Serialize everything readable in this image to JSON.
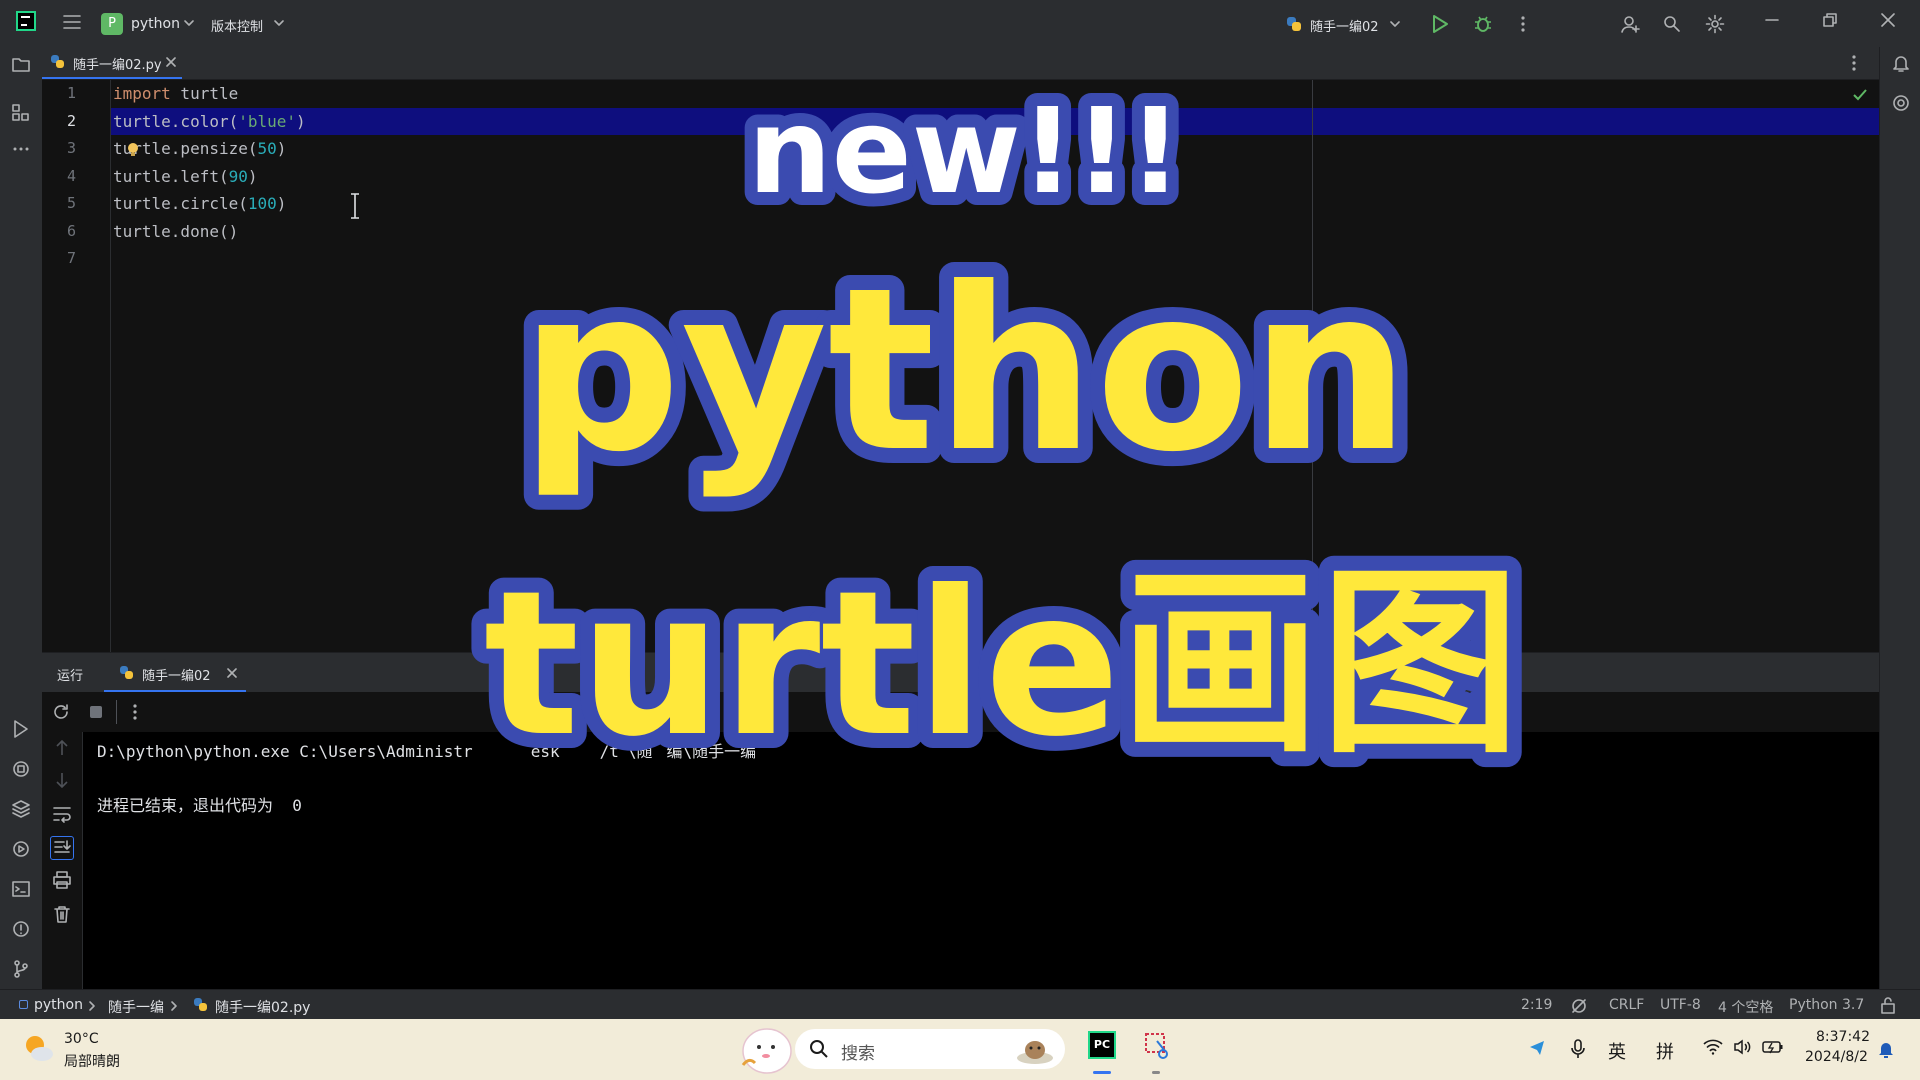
{
  "titlebar": {
    "project_badge": "P",
    "project_name": "python",
    "vcs_label": "版本控制",
    "run_config": "随手一编02"
  },
  "editor": {
    "tab_label": "随手一编02.py",
    "line_numbers": [
      "1",
      "2",
      "3",
      "4",
      "5",
      "6",
      "7"
    ],
    "code": {
      "l1_kw": "import",
      "l1_rest": " turtle",
      "l2_a": "turtle.color(",
      "l2_str": "'blue'",
      "l2_b": ")",
      "l3_a": "turtle.pensize(",
      "l3_num": "50",
      "l3_b": ")",
      "l4_a": "turtle.left(",
      "l4_num": "90",
      "l4_b": ")",
      "l5_a": "turtle.circle(",
      "l5_num": "100",
      "l5_b": ")",
      "l6": "turtle.done()"
    }
  },
  "run_panel": {
    "title": "运行",
    "tab_label": "随手一编02",
    "console": {
      "command": "D:\\python\\python.exe C:\\Users\\Administr",
      "command_tail": "esk",
      "command_tail2": "/t",
      "command_tail3": "\\随",
      "command_tail4": "编\\随手一编",
      "exit_message": "进程已结束，退出代码为  0"
    }
  },
  "statusbar": {
    "breadcrumb": [
      "python",
      "随手一编",
      "随手一编02.py"
    ],
    "cursor_pos": "2:19",
    "line_ending": "CRLF",
    "encoding": "UTF-8",
    "indent": "4 个空格",
    "interpreter": "Python 3.7"
  },
  "taskbar": {
    "weather_temp": "30°C",
    "weather_desc": "局部晴朗",
    "search_placeholder": "搜索",
    "pycharm_label": "PC",
    "ime_lang": "英",
    "ime_mode": "拼",
    "time": "8:37:42",
    "date": "2024/8/2"
  },
  "overlay": {
    "line1": "new!!!",
    "line2": "python",
    "line3": "turtle画图"
  },
  "colors": {
    "accent": "#3574f0",
    "overlay_fill": "#ffe83b",
    "overlay_stroke": "#3b4bb0",
    "line_highlight": "#0e0e7e",
    "pycharm_green": "#21d789"
  }
}
